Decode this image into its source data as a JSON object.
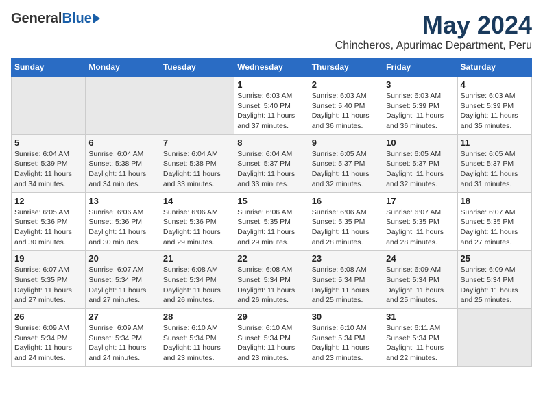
{
  "header": {
    "logo": {
      "general": "General",
      "blue": "Blue"
    },
    "title": "May 2024",
    "subtitle": "Chincheros, Apurimac Department, Peru"
  },
  "calendar": {
    "days_of_week": [
      "Sunday",
      "Monday",
      "Tuesday",
      "Wednesday",
      "Thursday",
      "Friday",
      "Saturday"
    ],
    "weeks": [
      [
        {
          "day": "",
          "info": ""
        },
        {
          "day": "",
          "info": ""
        },
        {
          "day": "",
          "info": ""
        },
        {
          "day": "1",
          "info": "Sunrise: 6:03 AM\nSunset: 5:40 PM\nDaylight: 11 hours\nand 37 minutes."
        },
        {
          "day": "2",
          "info": "Sunrise: 6:03 AM\nSunset: 5:40 PM\nDaylight: 11 hours\nand 36 minutes."
        },
        {
          "day": "3",
          "info": "Sunrise: 6:03 AM\nSunset: 5:39 PM\nDaylight: 11 hours\nand 36 minutes."
        },
        {
          "day": "4",
          "info": "Sunrise: 6:03 AM\nSunset: 5:39 PM\nDaylight: 11 hours\nand 35 minutes."
        }
      ],
      [
        {
          "day": "5",
          "info": "Sunrise: 6:04 AM\nSunset: 5:39 PM\nDaylight: 11 hours\nand 34 minutes."
        },
        {
          "day": "6",
          "info": "Sunrise: 6:04 AM\nSunset: 5:38 PM\nDaylight: 11 hours\nand 34 minutes."
        },
        {
          "day": "7",
          "info": "Sunrise: 6:04 AM\nSunset: 5:38 PM\nDaylight: 11 hours\nand 33 minutes."
        },
        {
          "day": "8",
          "info": "Sunrise: 6:04 AM\nSunset: 5:37 PM\nDaylight: 11 hours\nand 33 minutes."
        },
        {
          "day": "9",
          "info": "Sunrise: 6:05 AM\nSunset: 5:37 PM\nDaylight: 11 hours\nand 32 minutes."
        },
        {
          "day": "10",
          "info": "Sunrise: 6:05 AM\nSunset: 5:37 PM\nDaylight: 11 hours\nand 32 minutes."
        },
        {
          "day": "11",
          "info": "Sunrise: 6:05 AM\nSunset: 5:37 PM\nDaylight: 11 hours\nand 31 minutes."
        }
      ],
      [
        {
          "day": "12",
          "info": "Sunrise: 6:05 AM\nSunset: 5:36 PM\nDaylight: 11 hours\nand 30 minutes."
        },
        {
          "day": "13",
          "info": "Sunrise: 6:06 AM\nSunset: 5:36 PM\nDaylight: 11 hours\nand 30 minutes."
        },
        {
          "day": "14",
          "info": "Sunrise: 6:06 AM\nSunset: 5:36 PM\nDaylight: 11 hours\nand 29 minutes."
        },
        {
          "day": "15",
          "info": "Sunrise: 6:06 AM\nSunset: 5:35 PM\nDaylight: 11 hours\nand 29 minutes."
        },
        {
          "day": "16",
          "info": "Sunrise: 6:06 AM\nSunset: 5:35 PM\nDaylight: 11 hours\nand 28 minutes."
        },
        {
          "day": "17",
          "info": "Sunrise: 6:07 AM\nSunset: 5:35 PM\nDaylight: 11 hours\nand 28 minutes."
        },
        {
          "day": "18",
          "info": "Sunrise: 6:07 AM\nSunset: 5:35 PM\nDaylight: 11 hours\nand 27 minutes."
        }
      ],
      [
        {
          "day": "19",
          "info": "Sunrise: 6:07 AM\nSunset: 5:35 PM\nDaylight: 11 hours\nand 27 minutes."
        },
        {
          "day": "20",
          "info": "Sunrise: 6:07 AM\nSunset: 5:34 PM\nDaylight: 11 hours\nand 27 minutes."
        },
        {
          "day": "21",
          "info": "Sunrise: 6:08 AM\nSunset: 5:34 PM\nDaylight: 11 hours\nand 26 minutes."
        },
        {
          "day": "22",
          "info": "Sunrise: 6:08 AM\nSunset: 5:34 PM\nDaylight: 11 hours\nand 26 minutes."
        },
        {
          "day": "23",
          "info": "Sunrise: 6:08 AM\nSunset: 5:34 PM\nDaylight: 11 hours\nand 25 minutes."
        },
        {
          "day": "24",
          "info": "Sunrise: 6:09 AM\nSunset: 5:34 PM\nDaylight: 11 hours\nand 25 minutes."
        },
        {
          "day": "25",
          "info": "Sunrise: 6:09 AM\nSunset: 5:34 PM\nDaylight: 11 hours\nand 25 minutes."
        }
      ],
      [
        {
          "day": "26",
          "info": "Sunrise: 6:09 AM\nSunset: 5:34 PM\nDaylight: 11 hours\nand 24 minutes."
        },
        {
          "day": "27",
          "info": "Sunrise: 6:09 AM\nSunset: 5:34 PM\nDaylight: 11 hours\nand 24 minutes."
        },
        {
          "day": "28",
          "info": "Sunrise: 6:10 AM\nSunset: 5:34 PM\nDaylight: 11 hours\nand 23 minutes."
        },
        {
          "day": "29",
          "info": "Sunrise: 6:10 AM\nSunset: 5:34 PM\nDaylight: 11 hours\nand 23 minutes."
        },
        {
          "day": "30",
          "info": "Sunrise: 6:10 AM\nSunset: 5:34 PM\nDaylight: 11 hours\nand 23 minutes."
        },
        {
          "day": "31",
          "info": "Sunrise: 6:11 AM\nSunset: 5:34 PM\nDaylight: 11 hours\nand 22 minutes."
        },
        {
          "day": "",
          "info": ""
        }
      ]
    ]
  }
}
